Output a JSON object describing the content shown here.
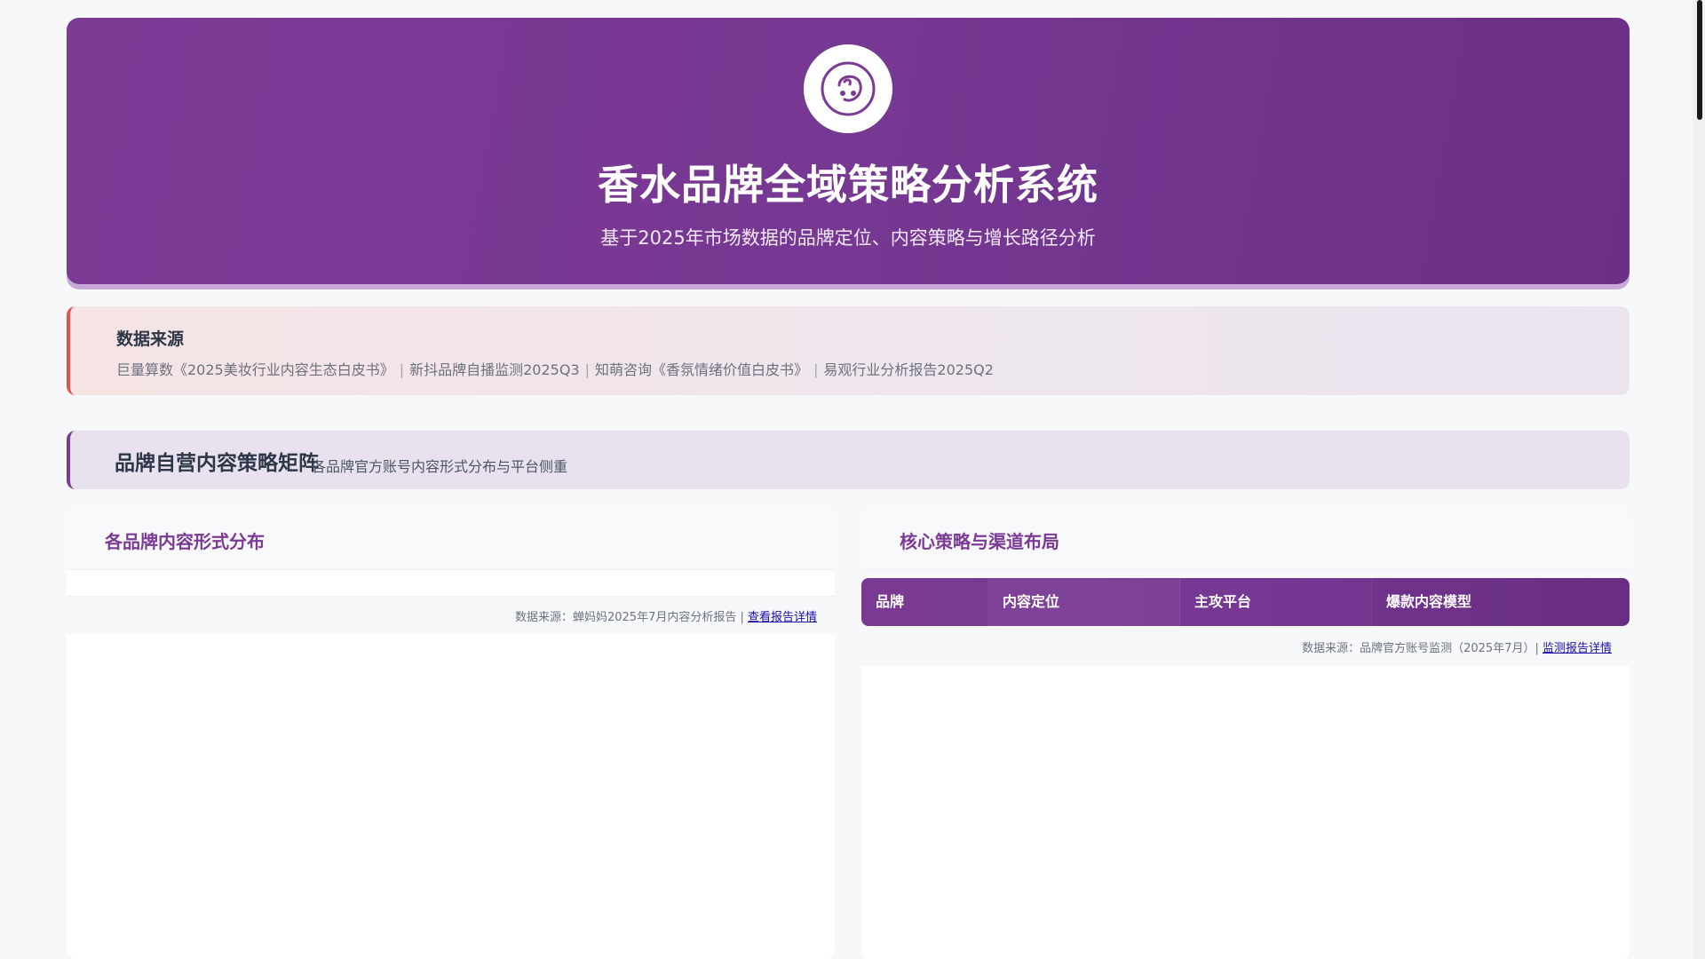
{
  "header": {
    "logo_icon": "perfume-face-icon",
    "title": "香水品牌全域策略分析系统",
    "subtitle": "基于2025年市场数据的品牌定位、内容策略与增长路径分析"
  },
  "sources": {
    "title": "数据来源",
    "items": [
      "巨量算数《2025美妆行业内容生态白皮书》",
      "新抖品牌自播监测2025Q3",
      "知萌咨询《香氛情绪价值白皮书》",
      "易观行业分析报告2025Q2"
    ],
    "separator": "|"
  },
  "section": {
    "title": "品牌自营内容策略矩阵",
    "description": "各品牌官方账号内容形式分布与平台侧重"
  },
  "left_card": {
    "title": "各品牌内容形式分布",
    "note_text": "数据来源：蝉妈妈2025年7月内容分析报告 | ",
    "note_link": "查看报告详情"
  },
  "right_card": {
    "title": "核心策略与渠道布局",
    "columns": [
      "品牌",
      "内容定位",
      "主攻平台",
      "爆款内容模型"
    ],
    "note_text": "数据来源：品牌官方账号监测（2025年7月）| ",
    "note_link": "监测报告详情"
  },
  "colors": {
    "brand_purple": "#7b3a94",
    "accent_red": "#e0574a"
  }
}
